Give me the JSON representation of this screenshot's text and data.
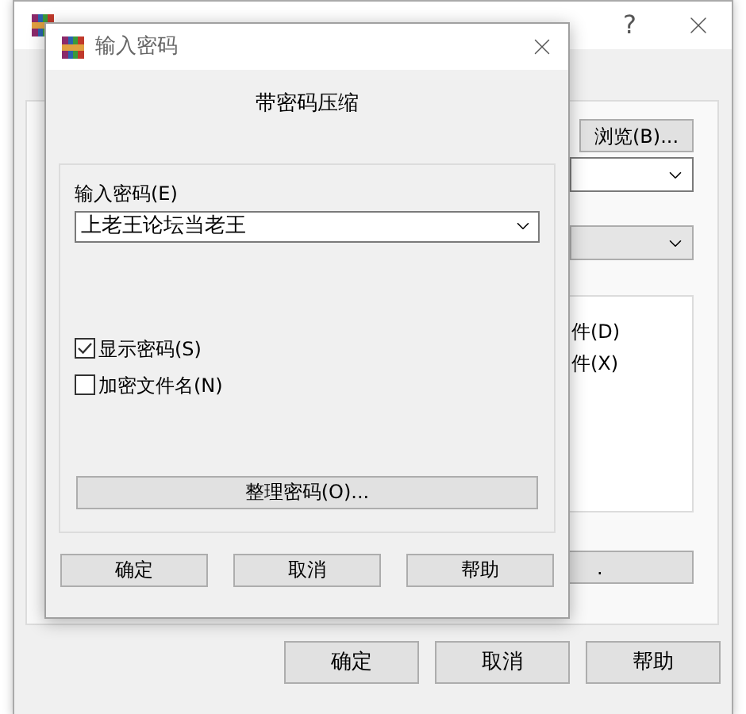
{
  "background_window": {
    "help_glyph": "?",
    "browse_button": "浏览(B)...",
    "options": [
      {
        "label": "件(D)"
      },
      {
        "label": "件(X)"
      }
    ],
    "button_fragment": ".",
    "buttons": [
      "确定",
      "取消",
      "帮助"
    ]
  },
  "dialog": {
    "title": "输入密码",
    "heading": "带密码压缩",
    "password_label": "输入密码(E)",
    "password_value": "上老王论坛当老王",
    "checkboxes": [
      {
        "label": "显示密码(S)",
        "checked": true
      },
      {
        "label": "加密文件名(N)",
        "checked": false
      }
    ],
    "organize_button": "整理密码(O)...",
    "buttons": [
      "确定",
      "取消",
      "帮助"
    ]
  }
}
